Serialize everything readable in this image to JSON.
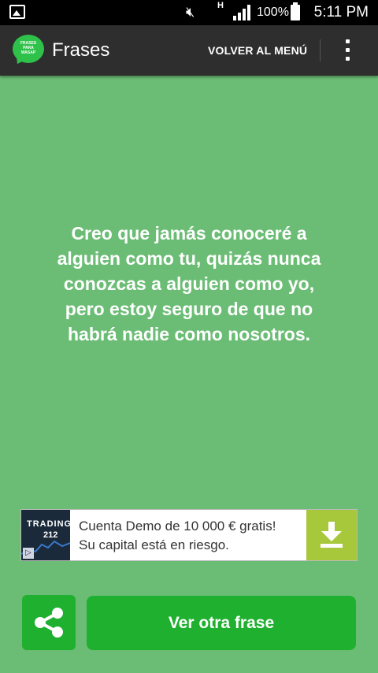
{
  "status_bar": {
    "network": "H",
    "battery_percent": "100%",
    "time": "5:11 PM"
  },
  "app_bar": {
    "logo_text": [
      "FRASES",
      "PARA",
      "WASAP"
    ],
    "title": "Frases",
    "back_to_menu_label": "VOLVER AL MENÚ"
  },
  "quote": {
    "text": "Creo que jamás conoceré a alguien como tu, quizás nunca conozcas a alguien como yo, pero estoy seguro de que no habrá nadie como nosotros."
  },
  "ad": {
    "brand_line1": "TRADING",
    "brand_line2": "212",
    "line1": "Cuenta Demo de 10 000 € gratis!",
    "line2": "Su capital está en riesgo.",
    "accent_color": "#a8c83b"
  },
  "actions": {
    "next_label": "Ver otra frase",
    "button_color": "#20b030"
  },
  "colors": {
    "background": "#6bbd75",
    "app_bar": "#2e2e2e"
  }
}
